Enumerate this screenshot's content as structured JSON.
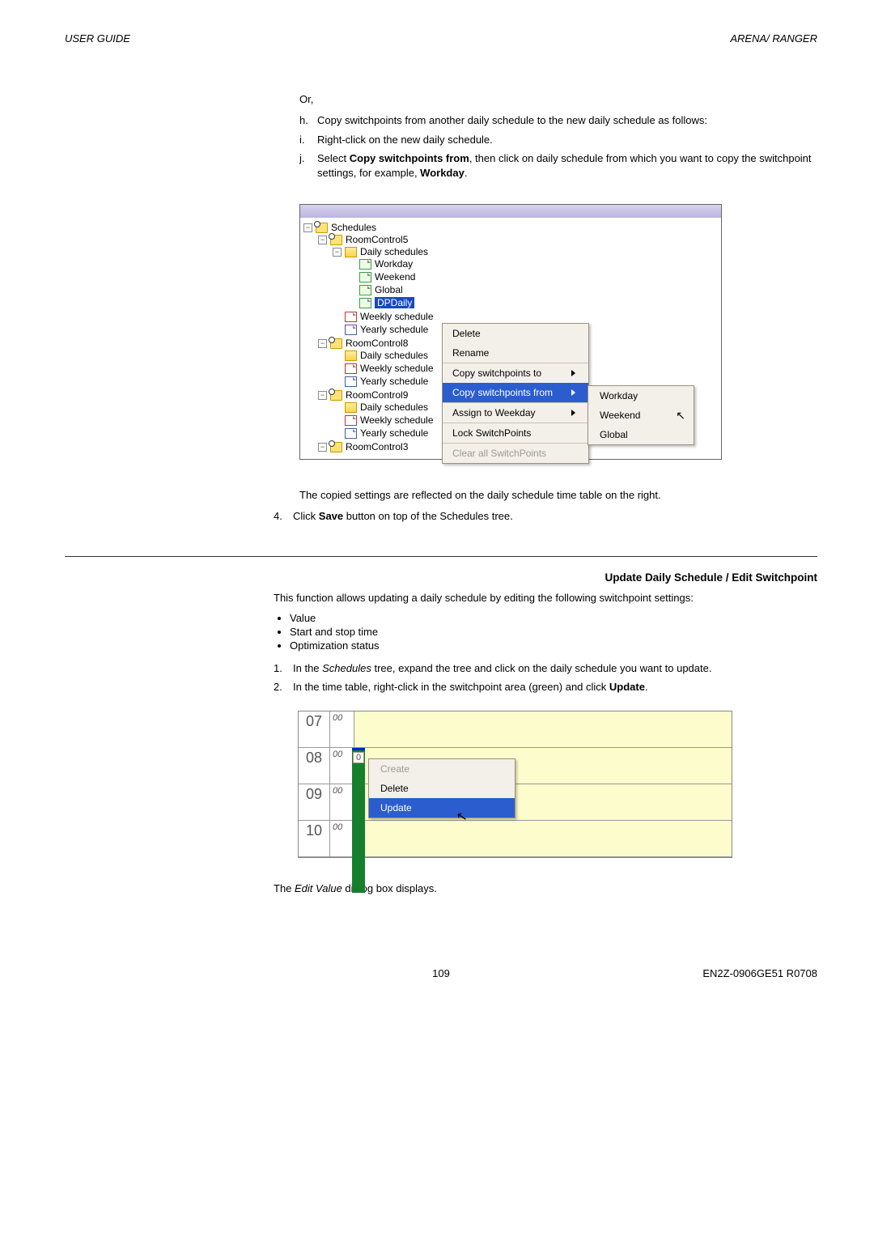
{
  "header": {
    "left": "USER GUIDE",
    "right": "ARENA/ RANGER"
  },
  "intro": {
    "or_label": "Or,",
    "h_text_pre": "Copy switchpoints from another daily schedule to the new daily schedule as follows:",
    "i_text": "Right-click on the new daily schedule.",
    "j_prefix": "Select ",
    "j_bold1": "Copy switchpoints from",
    "j_mid": ", then click on daily schedule from which you want to copy the switchpoint settings, for example, ",
    "j_bold2": "Workday",
    "j_end": "."
  },
  "tree": {
    "root": "Schedules",
    "rc5": "RoomControl5",
    "rc5_ds": "Daily schedules",
    "rc5_workday": "Workday",
    "rc5_weekend": "Weekend",
    "rc5_global": "Global",
    "rc5_dpdaily": "DPDaily",
    "rc5_weekly": "Weekly schedule",
    "rc5_yearly": "Yearly schedule",
    "rc8": "RoomControl8",
    "rc8_ds": "Daily schedules",
    "rc8_weekly": "Weekly schedule",
    "rc8_yearly": "Yearly schedule",
    "rc9": "RoomControl9",
    "rc9_ds": "Daily schedules",
    "rc9_weekly": "Weekly schedule",
    "rc9_yearly": "Yearly schedule",
    "rc3": "RoomControl3"
  },
  "ctx": {
    "delete": "Delete",
    "rename": "Rename",
    "copy_to": "Copy switchpoints to",
    "copy_from": "Copy switchpoints from",
    "assign": "Assign to Weekday",
    "lock": "Lock SwitchPoints",
    "clear": "Clear all SwitchPoints"
  },
  "submenu": {
    "workday": "Workday",
    "weekend": "Weekend",
    "global": "Global"
  },
  "after_fig1": {
    "copied_note": "The copied settings are reflected on the daily schedule time table on the right.",
    "step4_prefix": "Click ",
    "step4_bold": "Save",
    "step4_suffix": " button on top of the Schedules tree."
  },
  "section2": {
    "title": "Update Daily Schedule / Edit Switchpoint",
    "intro": "This function allows updating a daily schedule by editing the following switchpoint settings:",
    "b1": "Value",
    "b2": "Start and stop time",
    "b3": "Optimization status",
    "step1_pre": "In the ",
    "step1_em": "Schedules",
    "step1_post": " tree, expand the tree and click on the daily schedule you want to update.",
    "step2_pre": "In the time table, right-click in the switchpoint area (green) and click ",
    "step2_bold": "Update",
    "step2_end": "."
  },
  "timetable": {
    "h07": "07",
    "h08": "08",
    "h09": "09",
    "h10": "10",
    "m": "00",
    "green_val": "0",
    "m_create": "Create",
    "m_delete": "Delete",
    "m_update": "Update"
  },
  "after_fig2": {
    "dialog_pre": "The ",
    "dialog_em": "Edit Value",
    "dialog_post": " dialog box displays."
  },
  "footer": {
    "page": "109",
    "docid": "EN2Z-0906GE51 R0708"
  }
}
